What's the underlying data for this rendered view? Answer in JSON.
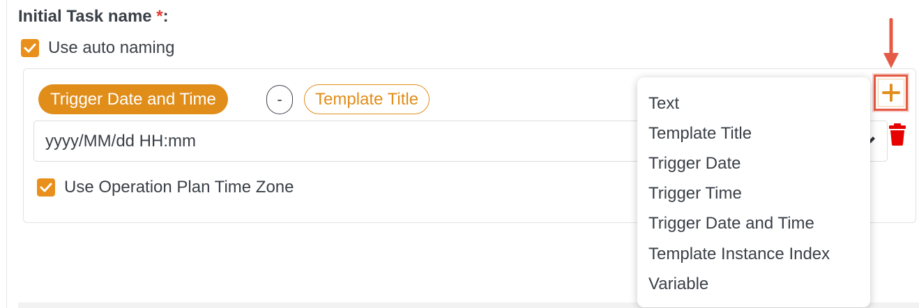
{
  "section": {
    "label": "Initial Task name ",
    "required_mark": "*",
    "colon": ":"
  },
  "auto_naming": {
    "checked": true,
    "label": "Use auto naming"
  },
  "name_parts": {
    "chips": [
      {
        "label": "Trigger Date and Time",
        "style": "filled"
      },
      {
        "label": "-",
        "style": "separator"
      },
      {
        "label": "Template Title",
        "style": "outline"
      }
    ]
  },
  "format_field": {
    "value": "yyyy/MM/dd HH:mm"
  },
  "time_zone": {
    "checked": true,
    "label": "Use Operation Plan Time Zone"
  },
  "add_menu": {
    "items": [
      "Text",
      "Template Title",
      "Trigger Date",
      "Trigger Time",
      "Trigger Date and Time",
      "Template Instance Index",
      "Variable"
    ]
  },
  "icons": {
    "add": "plus-icon",
    "delete": "trash-icon",
    "edit": "pencil-icon",
    "checkbox": "checkmark-icon",
    "annotation": "arrow-down-icon"
  },
  "colors": {
    "accent": "#e18d19",
    "required": "#e53935",
    "delete": "#e60000",
    "highlight": "#e45a45",
    "text": "#3a3f47"
  }
}
